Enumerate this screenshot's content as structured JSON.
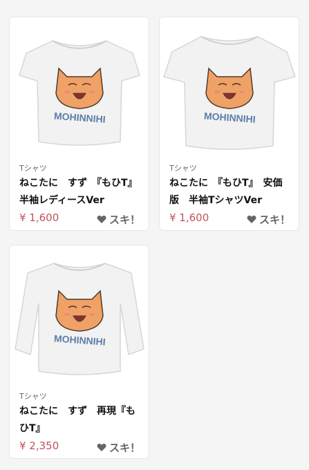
{
  "colors": {
    "price": "#c0535e",
    "cat_face": "#f0a165",
    "cat_outline": "#4a3a30",
    "print_text": "#5d7ea8",
    "shirt": "#f2f2f2"
  },
  "products": [
    {
      "category": "Tシャツ",
      "title": "ねこたに　すず　『もひT』　半袖レディースVer",
      "price": "¥ 1,600",
      "like_label": "スキ！",
      "print_text": "MOHINNIHI",
      "style": "ladies-tee"
    },
    {
      "category": "Tシャツ",
      "title": "ねこたに　『もひT』　安価版　半袖TシャツVer",
      "price": "¥ 1,600",
      "like_label": "スキ！",
      "print_text": "MOHINNIHI",
      "style": "tee"
    },
    {
      "category": "Tシャツ",
      "title": "ねこたに　すず　再現『もひT』",
      "price": "¥ 2,350",
      "like_label": "スキ！",
      "print_text": "MOHINNIHI",
      "style": "long-sleeve"
    }
  ]
}
